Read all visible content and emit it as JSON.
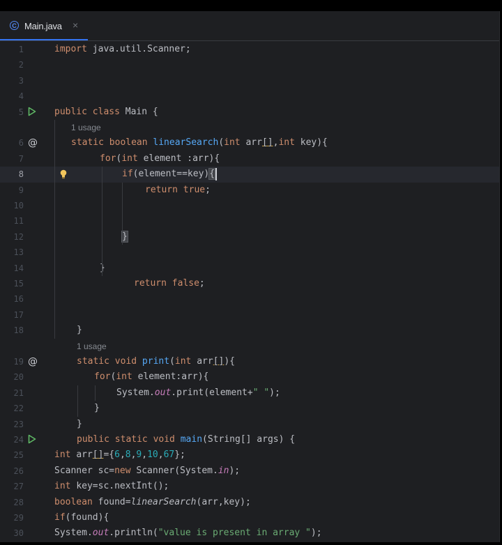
{
  "tab": {
    "icon": "class-icon",
    "icon_glyph": "C",
    "label": "Main.java",
    "close_glyph": "×"
  },
  "current_line": 8,
  "gutter": {
    "run_lines": [
      5,
      24
    ],
    "override_lines": [
      6,
      19
    ],
    "bulb_line": 8
  },
  "lines": [
    {
      "n": "1",
      "tokens": [
        [
          "kw",
          "import "
        ],
        [
          "",
          "java.util.Scanner;"
        ]
      ]
    },
    {
      "n": "2",
      "tokens": []
    },
    {
      "n": "3",
      "tokens": []
    },
    {
      "n": "4",
      "tokens": []
    },
    {
      "n": "5",
      "tokens": [
        [
          "kw",
          "public class "
        ],
        [
          "",
          "Main {"
        ]
      ]
    },
    {
      "n": "",
      "hint": "1 usage"
    },
    {
      "n": "6",
      "tokens": [
        [
          "kw",
          "static boolean "
        ],
        [
          "fn",
          "linearSearch"
        ],
        [
          "",
          "("
        ],
        [
          "kw",
          "int "
        ],
        [
          "",
          "arr"
        ],
        [
          "warn",
          "[]"
        ],
        [
          "",
          ","
        ],
        [
          "kw",
          "int "
        ],
        [
          "",
          "key){"
        ]
      ]
    },
    {
      "n": "7",
      "tokens": [
        [
          "kw",
          "for"
        ],
        [
          "",
          "("
        ],
        [
          "kw",
          "int "
        ],
        [
          "",
          "element :arr){"
        ]
      ]
    },
    {
      "n": "8",
      "tokens": [
        [
          "kw",
          "if"
        ],
        [
          "",
          "(element==key)"
        ],
        [
          "brace",
          "{"
        ]
      ]
    },
    {
      "n": "9",
      "tokens": [
        [
          "kw",
          "return true"
        ],
        [
          "",
          ";"
        ]
      ]
    },
    {
      "n": "10",
      "tokens": []
    },
    {
      "n": "11",
      "tokens": []
    },
    {
      "n": "12",
      "tokens": [
        [
          "brace",
          "}"
        ]
      ]
    },
    {
      "n": "13",
      "tokens": []
    },
    {
      "n": "14",
      "tokens": [
        [
          "",
          "}"
        ]
      ]
    },
    {
      "n": "15",
      "tokens": [
        [
          "kw",
          "return false"
        ],
        [
          "",
          ";"
        ]
      ]
    },
    {
      "n": "16",
      "tokens": []
    },
    {
      "n": "17",
      "tokens": []
    },
    {
      "n": "18",
      "tokens": [
        [
          "",
          "}"
        ]
      ]
    },
    {
      "n": "",
      "hint": "1 usage"
    },
    {
      "n": "19",
      "tokens": [
        [
          "kw",
          "static void "
        ],
        [
          "fn",
          "print"
        ],
        [
          "",
          "("
        ],
        [
          "kw",
          "int "
        ],
        [
          "",
          "arr"
        ],
        [
          "warn",
          "[]"
        ],
        [
          "",
          "){"
        ]
      ]
    },
    {
      "n": "20",
      "tokens": [
        [
          "kw",
          "for"
        ],
        [
          "",
          "("
        ],
        [
          "kw",
          "int "
        ],
        [
          "",
          "element:arr){"
        ]
      ]
    },
    {
      "n": "21",
      "tokens": [
        [
          "",
          "System."
        ],
        [
          "static",
          "out"
        ],
        [
          "",
          ".print(element+"
        ],
        [
          "str",
          "\" \""
        ],
        [
          "",
          ");"
        ]
      ]
    },
    {
      "n": "22",
      "tokens": [
        [
          "",
          "}"
        ]
      ]
    },
    {
      "n": "23",
      "tokens": [
        [
          "",
          "}"
        ]
      ]
    },
    {
      "n": "24",
      "tokens": [
        [
          "kw",
          "public static void "
        ],
        [
          "fn",
          "main"
        ],
        [
          "",
          "(String[] args) {"
        ]
      ]
    },
    {
      "n": "25",
      "tokens": [
        [
          "kw",
          "int "
        ],
        [
          "",
          "arr"
        ],
        [
          "warn",
          "[]"
        ],
        [
          "",
          "={"
        ],
        [
          "num",
          "6"
        ],
        [
          "",
          ","
        ],
        [
          "num",
          "8"
        ],
        [
          "",
          ","
        ],
        [
          "num",
          "9"
        ],
        [
          "",
          ","
        ],
        [
          "num",
          "10"
        ],
        [
          "",
          ","
        ],
        [
          "num",
          "67"
        ],
        [
          "",
          "};"
        ]
      ]
    },
    {
      "n": "26",
      "tokens": [
        [
          "",
          "Scanner sc="
        ],
        [
          "kw",
          "new "
        ],
        [
          "",
          "Scanner(System."
        ],
        [
          "static",
          "in"
        ],
        [
          "",
          ");"
        ]
      ]
    },
    {
      "n": "27",
      "tokens": [
        [
          "kw",
          "int "
        ],
        [
          "",
          "key=sc.nextInt();"
        ]
      ]
    },
    {
      "n": "28",
      "tokens": [
        [
          "kw",
          "boolean "
        ],
        [
          "",
          "found="
        ],
        [
          "ital",
          "linearSearch"
        ],
        [
          "",
          "(arr,key);"
        ]
      ]
    },
    {
      "n": "29",
      "tokens": [
        [
          "kw",
          "if"
        ],
        [
          "",
          "(found){"
        ]
      ]
    },
    {
      "n": "30",
      "tokens": [
        [
          "",
          "System."
        ],
        [
          "static",
          "out"
        ],
        [
          "",
          ".println("
        ],
        [
          "str",
          "\"value is present in array \""
        ],
        [
          "",
          ");"
        ]
      ]
    }
  ]
}
